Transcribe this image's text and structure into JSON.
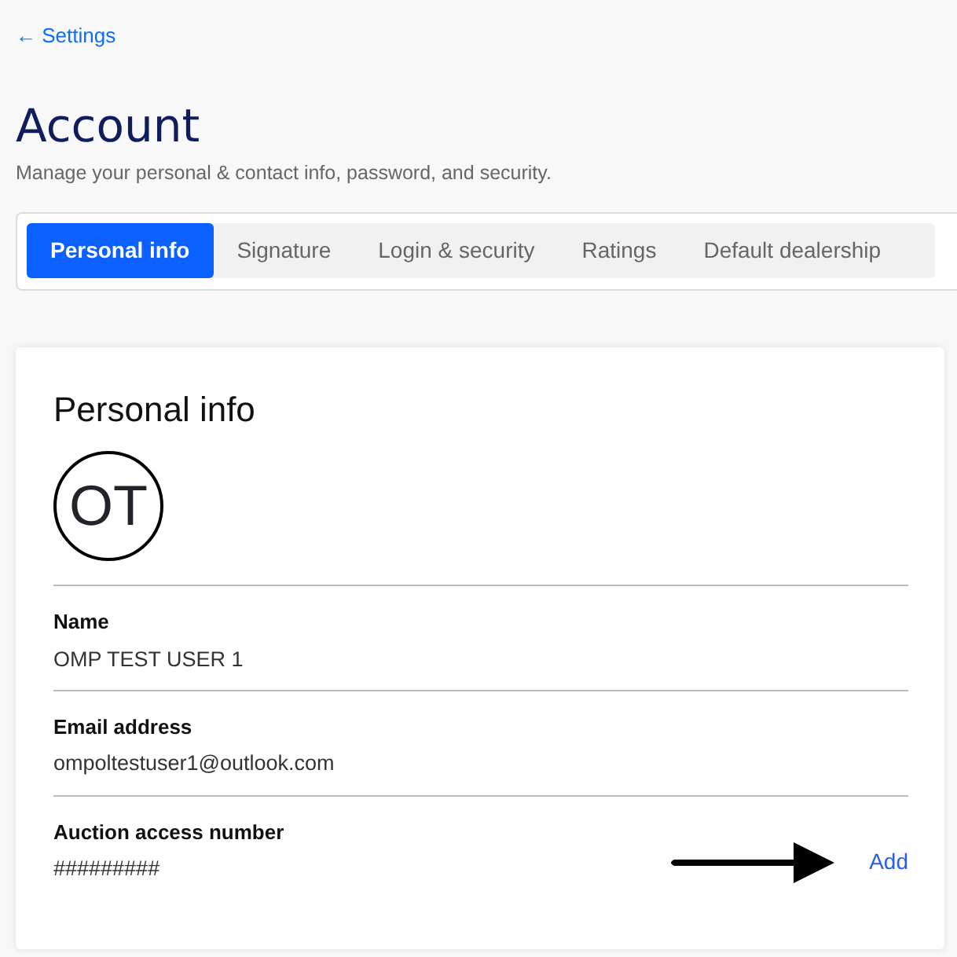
{
  "back_link": {
    "icon": "←",
    "label": "Settings"
  },
  "page": {
    "title": "Account",
    "subtitle": "Manage your personal & contact info, password, and security."
  },
  "tabs": [
    {
      "label": "Personal info",
      "selected": true
    },
    {
      "label": "Signature",
      "selected": false
    },
    {
      "label": "Login & security",
      "selected": false
    },
    {
      "label": "Ratings",
      "selected": false
    },
    {
      "label": "Default dealership",
      "selected": false
    }
  ],
  "card": {
    "title": "Personal info",
    "avatar": "OT",
    "fields": [
      {
        "label": "Name",
        "value": "OMP TEST USER 1"
      },
      {
        "label": "Email address",
        "value": "ompoltestuser1@outlook.com"
      },
      {
        "label": "Auction access number",
        "value": "#########",
        "action": "Add"
      }
    ]
  }
}
